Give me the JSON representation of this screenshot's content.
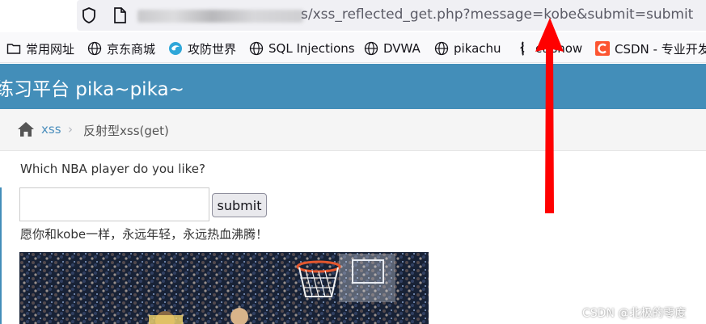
{
  "browser": {
    "url_visible": "s/xss_reflected_get.php?message=kobe&submit=submit",
    "icons": {
      "shield": "shield-icon",
      "page": "page-icon"
    }
  },
  "bookmarks": [
    {
      "label": "常用网址",
      "icon": "folder-icon"
    },
    {
      "label": "京东商城",
      "icon": "globe-icon"
    },
    {
      "label": "攻防世界",
      "icon": "site-icon"
    },
    {
      "label": "SQL Injections",
      "icon": "globe-icon"
    },
    {
      "label": "DVWA",
      "icon": "globe-icon"
    },
    {
      "label": "pikachu",
      "icon": "globe-icon"
    },
    {
      "label": "ctfshow",
      "icon": "ctfshow-icon"
    },
    {
      "label": "CSDN - 专业开发",
      "icon": "csdn-icon"
    }
  ],
  "header": {
    "title": "练习平台 pika~pika~"
  },
  "breadcrumb": {
    "link": "xss",
    "current": "反射型xss(get)"
  },
  "main": {
    "question": "Which NBA player do you like?",
    "input_value": "",
    "submit_label": "submit",
    "result": "愿你和kobe一样，永远年轻，永远热血沸腾！"
  },
  "watermark": "CSDN @北极的零度",
  "colors": {
    "header_bg": "#438eb9",
    "link": "#4c8fbd",
    "annotation_arrow": "#ff0000"
  }
}
